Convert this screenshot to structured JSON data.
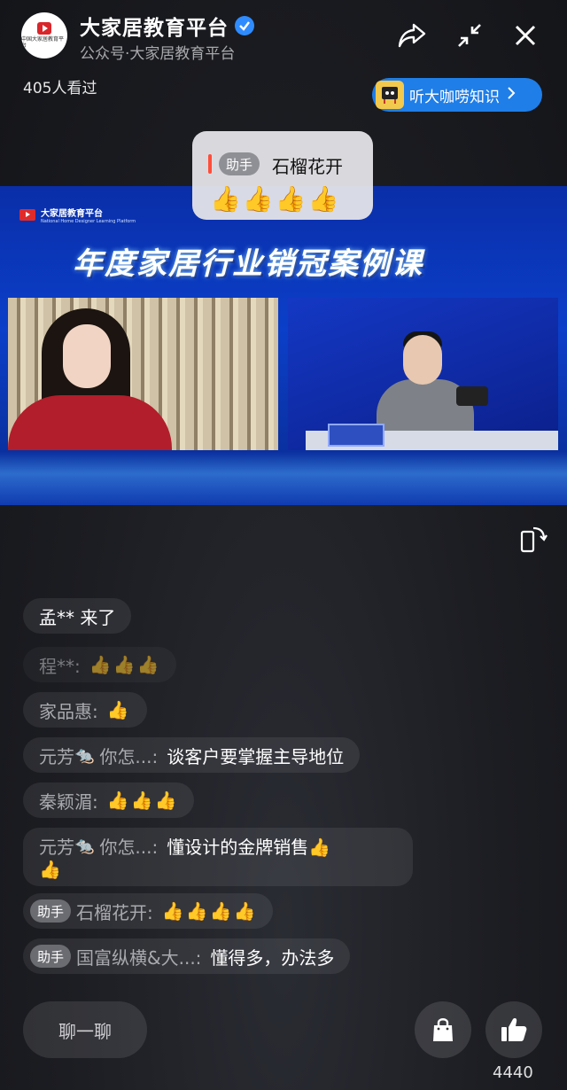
{
  "header": {
    "account_name": "大家居教育平台",
    "account_sub": "公众号·大家居教育平台",
    "avatar_text": "中国大家居教育平台",
    "viewers": "405人看过",
    "icons": [
      "share-icon",
      "minimize-icon",
      "close-icon"
    ]
  },
  "knowledge_pill": {
    "label": "听大咖唠知识",
    "icon": "audio-book-icon"
  },
  "popup": {
    "badge": "助手",
    "name": "石榴花开",
    "reaction": "👍👍👍👍"
  },
  "video": {
    "brand": "大家居教育平台",
    "brand_sub": "National Home Designer Learning Platform",
    "title": "年度家居行业销冠案例课"
  },
  "chat": [
    {
      "name": "孟** 来了",
      "msg": ""
    },
    {
      "name": "程**:",
      "msg": "👍👍👍"
    },
    {
      "name": "家品惠:",
      "msg": "👍"
    },
    {
      "name": "元芳",
      "name2": "你怎...:",
      "msg": "谈客户要掌握主导地位"
    },
    {
      "name": "秦颖湄:",
      "msg": "👍👍👍"
    },
    {
      "name": "元芳",
      "name2": "你怎...:",
      "msg": "懂设计的金牌销售👍",
      "msg2": "👍"
    },
    {
      "badge": "助手",
      "name": "石榴花开:",
      "msg": "👍👍👍👍"
    },
    {
      "badge": "助手",
      "name": "国富纵横&大...:",
      "msg": "懂得多，办法多"
    }
  ],
  "bottom": {
    "chat_button": "聊一聊",
    "like_count": "4440",
    "icons": [
      "shopping-bag-icon",
      "thumbs-up-icon"
    ]
  },
  "colors": {
    "accent_blue": "#1f7ee8",
    "badge_gray": "#6b6c71",
    "verified_blue": "#2f8cff"
  }
}
